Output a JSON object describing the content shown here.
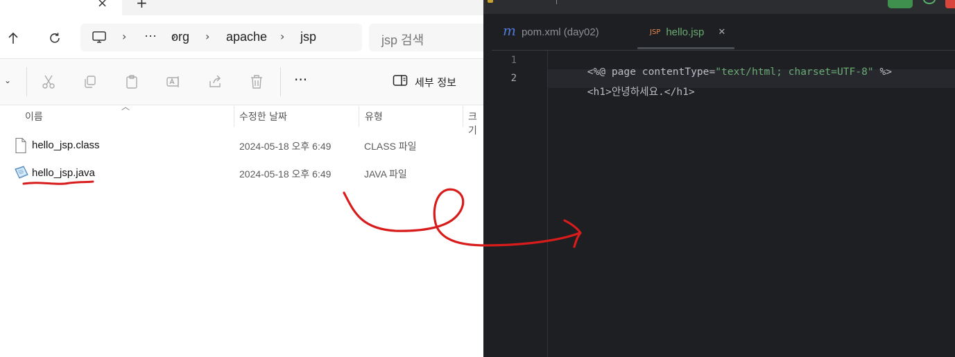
{
  "explorer": {
    "breadcrumb": {
      "overflow": "···",
      "items": [
        "org",
        "apache",
        "jsp"
      ]
    },
    "search": {
      "placeholder": "jsp 검색"
    },
    "toolbar": {
      "details_label": "세부 정보",
      "more": "···"
    },
    "columns": {
      "name": "이름",
      "date": "수정한 날짜",
      "type": "유형",
      "size": "크기"
    },
    "files": [
      {
        "name": "hello_jsp.class",
        "date": "2024-05-18 오후 6:49",
        "type": "CLASS 파일",
        "icon": "file-icon"
      },
      {
        "name": "hello_jsp.java",
        "date": "2024-05-18 오후 6:49",
        "type": "JAVA 파일",
        "icon": "java-file-icon"
      }
    ]
  },
  "ide": {
    "tabs": [
      {
        "icon_text": "m",
        "label": "pom.xml (day02)",
        "active": false
      },
      {
        "icon_text": "JSP",
        "label": "hello.jsp",
        "active": true,
        "close": "✕"
      }
    ],
    "lines": [
      {
        "no": "1",
        "segments": [
          {
            "t": "<%@ page contentType=",
            "k": "def"
          },
          {
            "t": "\"text/html; charset=UTF-8\"",
            "k": "str"
          },
          {
            "t": " %>",
            "k": "def"
          }
        ]
      },
      {
        "no": "2",
        "segments": [
          {
            "t": "<h1>안녕하세요.</h1>",
            "k": "def"
          }
        ]
      }
    ]
  },
  "colors": {
    "ide_bg": "#1e1f22",
    "ide_string": "#6aab73",
    "ide_text": "#bcbec4",
    "annotation_red": "#d81b1b",
    "ide_green_button": "#3f8f4f"
  }
}
